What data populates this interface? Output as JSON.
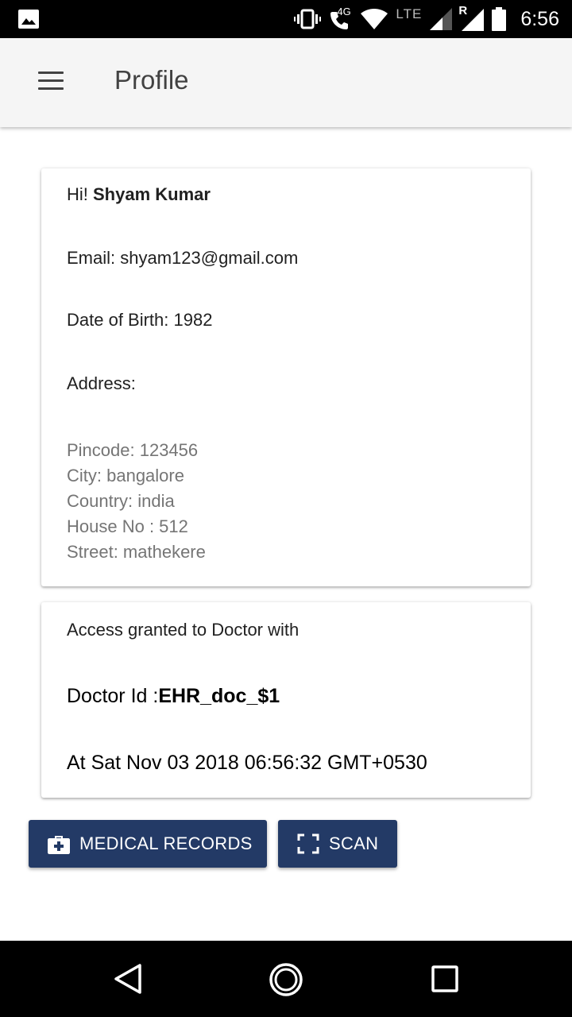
{
  "status_bar": {
    "network_label": "4G",
    "lte_label": "LTE",
    "roaming_label": "R",
    "time": "6:56"
  },
  "app_bar": {
    "title": "Profile"
  },
  "profile_card": {
    "greeting_prefix": "Hi! ",
    "user_name": "Shyam Kumar",
    "email": "Email: shyam123@gmail.com",
    "dob": "Date of Birth: 1982",
    "address_label": "Address:",
    "pincode": "Pincode: 123456",
    "city": "City: bangalore",
    "country": "Country: india",
    "house_no": "House No : 512",
    "street": "Street: mathekere"
  },
  "access_card": {
    "heading": "Access granted to Doctor with",
    "doctor_id_label": "Doctor Id :",
    "doctor_id": "EHR_doc_$1",
    "timestamp": "At Sat Nov 03 2018 06:56:32 GMT+0530"
  },
  "actions": {
    "medical_records_label": "MEDICAL RECORDS",
    "scan_label": "SCAN"
  },
  "icons": {
    "gallery": "image-icon",
    "vibrate": "vibrate-icon",
    "call": "phone-icon",
    "wifi": "wifi-icon",
    "signal": "signal-icon",
    "battery": "battery-icon",
    "menu": "hamburger-menu-icon",
    "medical": "medical-bag-icon",
    "scan": "scan-frame-icon",
    "back": "back-triangle-icon",
    "home": "home-circle-icon",
    "recents": "recents-square-icon"
  },
  "colors": {
    "button_bg": "#233a66",
    "app_bar_bg": "#f5f5f5"
  }
}
